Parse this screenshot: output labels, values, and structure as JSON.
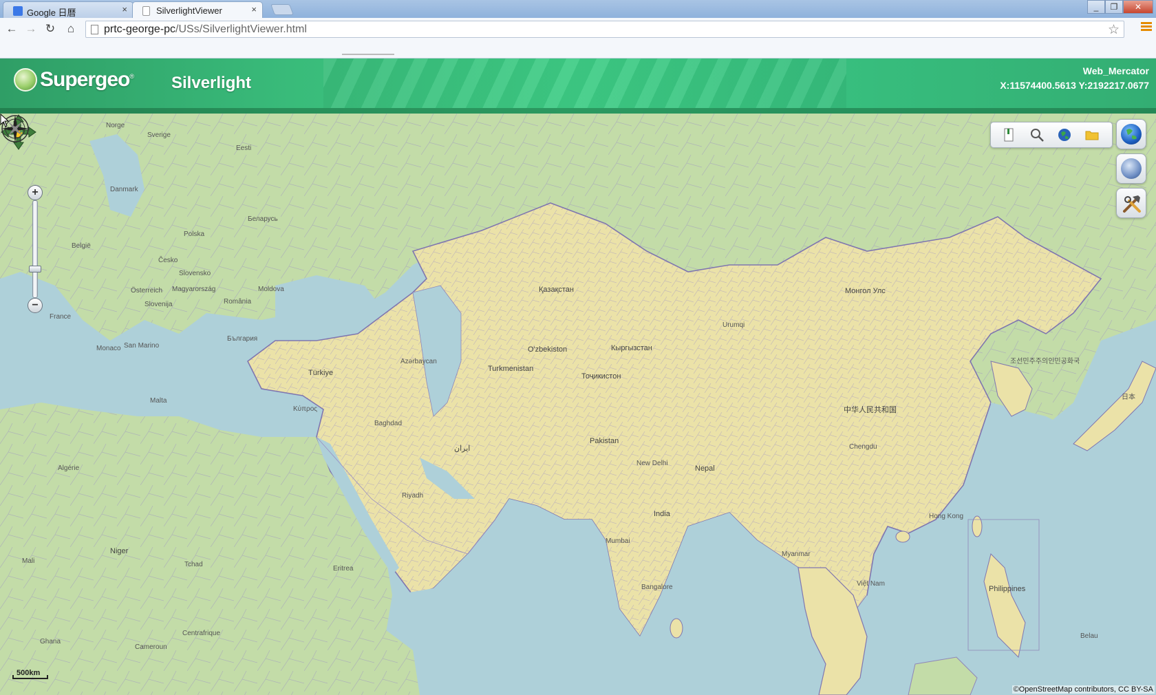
{
  "browser": {
    "tabs": [
      {
        "title": "Google 日曆",
        "active": false
      },
      {
        "title": "SilverlightViewer",
        "active": true
      }
    ],
    "url_host": "prtc-george-pc",
    "url_path": "/USs/SilverlightViewer.html",
    "close_glyph": "×"
  },
  "app": {
    "logo_text": "Supergeo",
    "logo_mark": "®",
    "title": "Silverlight",
    "projection": "Web_Mercator",
    "coordinates": "X:11574400.5613 Y:2192217.0677"
  },
  "map": {
    "scale_label": "500km",
    "attribution": "©OpenStreetMap contributors, CC BY-SA",
    "zoom_level_fraction": 0.28,
    "colors": {
      "sea": "#aed0d9",
      "land": "#c3dca8",
      "highlight": "#ebe2a8",
      "border": "#8f86b8"
    },
    "labels": [
      {
        "text": "Norge"
      },
      {
        "text": "Sverige"
      },
      {
        "text": "Eesti"
      },
      {
        "text": "Danmark"
      },
      {
        "text": "Беларусь"
      },
      {
        "text": "Polska"
      },
      {
        "text": "België"
      },
      {
        "text": "Česko"
      },
      {
        "text": "Slovensko"
      },
      {
        "text": "Österreich"
      },
      {
        "text": "Magyarország"
      },
      {
        "text": "România"
      },
      {
        "text": "Moldova"
      },
      {
        "text": "France"
      },
      {
        "text": "Monaco"
      },
      {
        "text": "San Marino"
      },
      {
        "text": "Slovenija"
      },
      {
        "text": "България"
      },
      {
        "text": "Türkiye"
      },
      {
        "text": "Azərbaycan"
      },
      {
        "text": "Malta"
      },
      {
        "text": "Κύπρος"
      },
      {
        "text": "Algérie"
      },
      {
        "text": "Niger"
      },
      {
        "text": "Mali"
      },
      {
        "text": "Tchad"
      },
      {
        "text": "Eritrea"
      },
      {
        "text": "Ghana"
      },
      {
        "text": "Cameroun"
      },
      {
        "text": "Centrafrique"
      },
      {
        "text": "Қазақстан"
      },
      {
        "text": "O'zbekiston"
      },
      {
        "text": "Turkmenistan"
      },
      {
        "text": "Кыргызстан"
      },
      {
        "text": "Тоҷикистон"
      },
      {
        "text": "Pakistan"
      },
      {
        "text": "Nepal"
      },
      {
        "text": "India"
      },
      {
        "text": "New Delhi"
      },
      {
        "text": "Mumbai"
      },
      {
        "text": "Bangalore"
      },
      {
        "text": "Myanmar"
      },
      {
        "text": "Việt Nam"
      },
      {
        "text": "Philippines"
      },
      {
        "text": "Монгол Улс"
      },
      {
        "text": "Urumqi"
      },
      {
        "text": "中华人民共和国"
      },
      {
        "text": "Chengdu"
      },
      {
        "text": "Hong Kong"
      },
      {
        "text": "조선민주주의인민공화국"
      },
      {
        "text": "日本"
      },
      {
        "text": "Riyadh"
      },
      {
        "text": "Baghdad"
      },
      {
        "text": "ایران"
      },
      {
        "text": "Belau"
      }
    ]
  }
}
